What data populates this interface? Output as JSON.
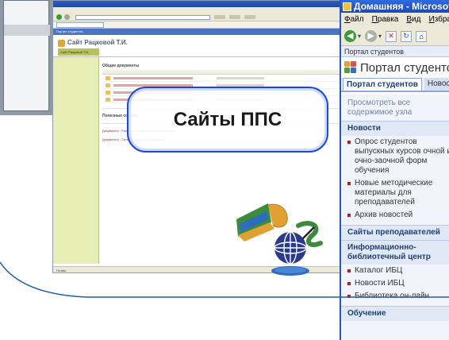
{
  "callout": {
    "text": "Сайты ППС"
  },
  "colors": {
    "callout_border": "#1e46d8",
    "curve": "#1a5fb4",
    "front_title_bar": "#2f6be0",
    "nav_heading": "#1f3f7a",
    "bullet": "#b51e1e",
    "site_accent": "#b4c35a"
  },
  "back_window": {
    "site_title": "Сайт Рацковой Т.И.",
    "site_tab": "Сайт Рацковой Т.И.",
    "portal_label": "Портал студентов",
    "docs_section": "Общие документы",
    "survey_section": "Полезные ссылки",
    "links": [
      "Документы - Разработка web-представительства",
      "Документы - Сетевое администрирование"
    ],
    "footer": "Готово"
  },
  "front_window": {
    "title": "Домашняя - Microsoft Internet Explorer",
    "menu": [
      "Файл",
      "Правка",
      "Вид",
      "Избранное"
    ],
    "breadcrumb": "Портал студентов",
    "portal_title": "Портал студентов",
    "tabs": {
      "active": "Портал студентов",
      "other": "Новости"
    },
    "view_all": "Просмотреть все содержимое узла",
    "nav": {
      "news_heading": "Новости",
      "news_items": [
        "Опрос студентов выпускных курсов очной и очно-заочной форм обучения",
        "Новые методические материалы для преподавателей",
        "Архив новостей"
      ],
      "teachers_heading": "Сайты преподавателей",
      "library_heading": "Информационно-библиотечный центр",
      "library_items": [
        "Каталог ИБЦ",
        "Новости ИБЦ",
        "Библиотека он-лайн"
      ],
      "education_heading": "Обучение"
    }
  }
}
